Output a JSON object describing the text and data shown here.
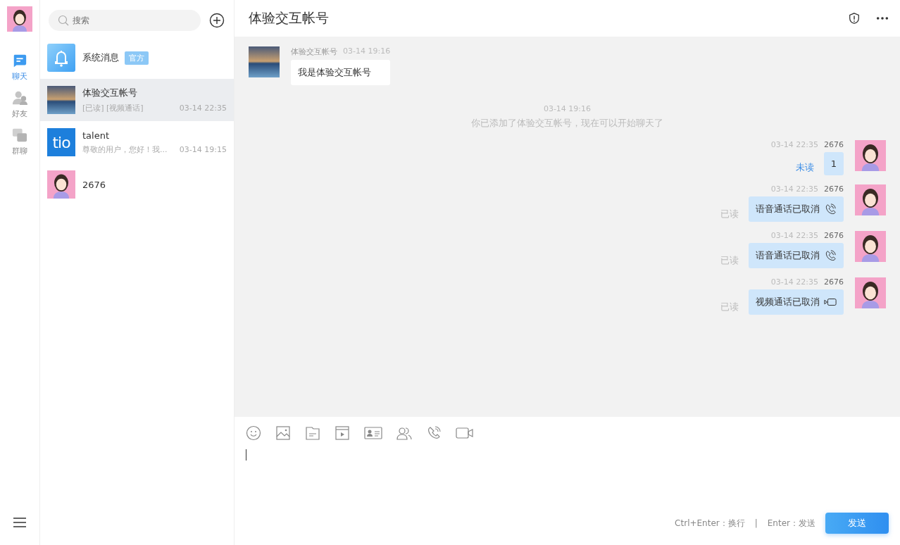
{
  "rail": {
    "nav": [
      {
        "kind": "chat",
        "label": "聊天",
        "selected": true
      },
      {
        "kind": "friends",
        "label": "好友",
        "selected": false
      },
      {
        "kind": "groups",
        "label": "群聊",
        "selected": false
      }
    ]
  },
  "search": {
    "placeholder": "搜索"
  },
  "conversations": [
    {
      "kind": "bell",
      "name": "系统消息",
      "badge": "官方",
      "selected": false
    },
    {
      "kind": "photo",
      "name": "体验交互帐号",
      "preview": "[已读] [视频通话]",
      "time": "03-14 22:35",
      "selected": true
    },
    {
      "kind": "logo",
      "logo_text": "tio",
      "name": "talent",
      "preview": "尊敬的用户，您好！我...",
      "time": "03-14 19:15",
      "selected": false
    },
    {
      "kind": "user",
      "name": "2676",
      "selected": false
    }
  ],
  "chat": {
    "title": "体验交互帐号",
    "messages": [
      {
        "kind": "incoming",
        "sender": "体验交互帐号",
        "time": "03-14 19:16",
        "text": "我是体验交互帐号"
      },
      {
        "kind": "system",
        "time": "03-14 19:16",
        "text": "你已添加了体验交互帐号，现在可以开始聊天了"
      },
      {
        "kind": "outgoing",
        "time": "03-14 22:35",
        "sender": "2676",
        "status": "未读",
        "read": false,
        "text": "1"
      },
      {
        "kind": "outgoing",
        "time": "03-14 22:35",
        "sender": "2676",
        "status": "已读",
        "read": true,
        "text": "语音通话已取消",
        "call": {
          "kind": "voice"
        }
      },
      {
        "kind": "outgoing",
        "time": "03-14 22:35",
        "sender": "2676",
        "status": "已读",
        "read": true,
        "text": "语音通话已取消",
        "call": {
          "kind": "voice"
        }
      },
      {
        "kind": "outgoing",
        "time": "03-14 22:35",
        "sender": "2676",
        "status": "已读",
        "read": true,
        "text": "视频通话已取消",
        "call": {
          "kind": "video"
        }
      }
    ],
    "hints": [
      "Ctrl+Enter：换行",
      "|",
      "Enter：发送"
    ],
    "send": "发送"
  }
}
